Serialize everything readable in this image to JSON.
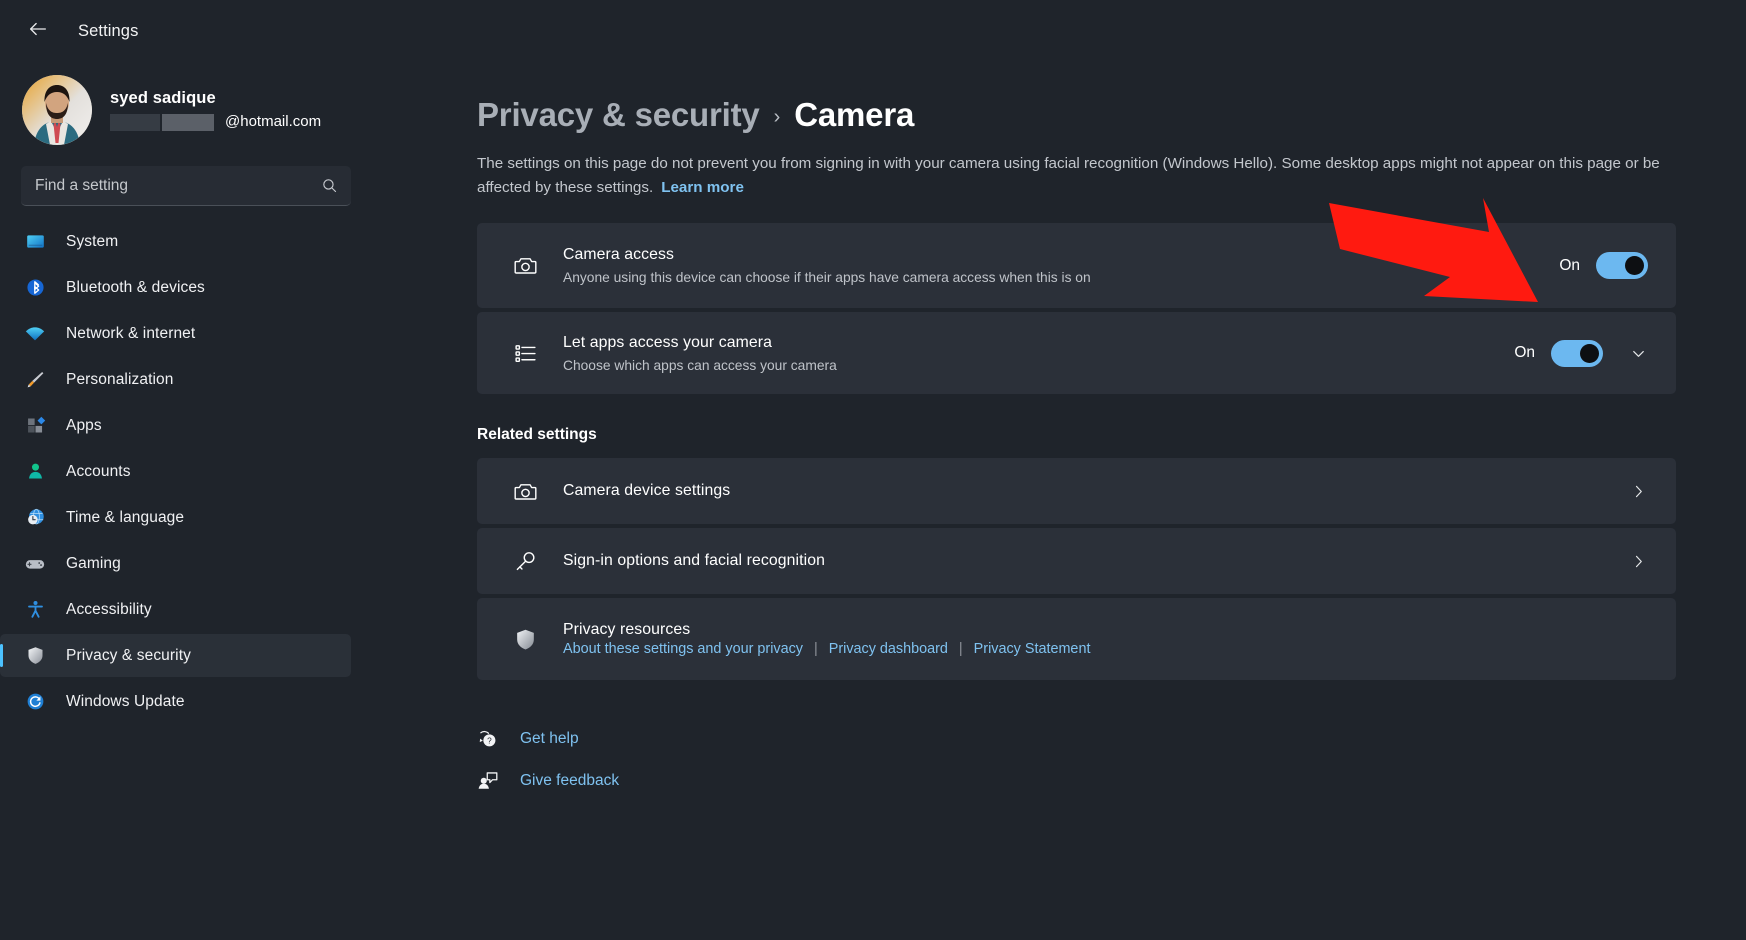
{
  "window": {
    "title": "Settings",
    "back_icon": "back-arrow-icon"
  },
  "account": {
    "name": "syed sadique",
    "email_suffix": "@hotmail.com",
    "email_redacted": true
  },
  "search": {
    "placeholder": "Find a setting",
    "value": "",
    "icon": "search-icon"
  },
  "sidebar": {
    "items": [
      {
        "label": "System",
        "icon": "monitor-icon",
        "selected": false
      },
      {
        "label": "Bluetooth & devices",
        "icon": "bluetooth-icon",
        "selected": false
      },
      {
        "label": "Network & internet",
        "icon": "wifi-icon",
        "selected": false
      },
      {
        "label": "Personalization",
        "icon": "paintbrush-icon",
        "selected": false
      },
      {
        "label": "Apps",
        "icon": "apps-icon",
        "selected": false
      },
      {
        "label": "Accounts",
        "icon": "person-icon",
        "selected": false
      },
      {
        "label": "Time & language",
        "icon": "clock-globe-icon",
        "selected": false
      },
      {
        "label": "Gaming",
        "icon": "gamepad-icon",
        "selected": false
      },
      {
        "label": "Accessibility",
        "icon": "accessibility-icon",
        "selected": false
      },
      {
        "label": "Privacy & security",
        "icon": "shield-icon",
        "selected": true
      },
      {
        "label": "Windows Update",
        "icon": "update-icon",
        "selected": false
      }
    ]
  },
  "header": {
    "breadcrumb_parent": "Privacy & security",
    "breadcrumb_separator": "›",
    "breadcrumb_current": "Camera",
    "description": "The settings on this page do not prevent you from signing in with your camera using facial recognition (Windows Hello). Some desktop apps might not appear on this page or be affected by these settings.",
    "learn_more": "Learn more"
  },
  "settings": {
    "camera_access": {
      "title": "Camera access",
      "subtitle": "Anyone using this device can choose if their apps have camera access when this is on",
      "icon": "camera-icon",
      "toggle_state": "On",
      "toggle_on": true
    },
    "let_apps_access": {
      "title": "Let apps access your camera",
      "subtitle": "Choose which apps can access your camera",
      "icon": "list-icon",
      "toggle_state": "On",
      "toggle_on": true,
      "expand_icon": "chevron-down-icon"
    }
  },
  "related": {
    "heading": "Related settings",
    "items": [
      {
        "title": "Camera device settings",
        "icon": "camera-icon",
        "chevron": "chevron-right-icon"
      },
      {
        "title": "Sign-in options and facial recognition",
        "icon": "key-icon",
        "chevron": "chevron-right-icon"
      }
    ],
    "privacy_resources": {
      "title": "Privacy resources",
      "icon": "shield-icon",
      "links": [
        "About these settings and your privacy",
        "Privacy dashboard",
        "Privacy Statement"
      ],
      "separator": "|"
    }
  },
  "footer": {
    "get_help": {
      "label": "Get help",
      "icon": "help-icon"
    },
    "give_feedback": {
      "label": "Give feedback",
      "icon": "feedback-icon"
    }
  },
  "annotation": {
    "type": "arrow",
    "color": "#FF1A10",
    "points_to": "camera-access-toggle"
  },
  "colors": {
    "background": "#1f242b",
    "card": "#2b3039",
    "accent": "#4cc2ff",
    "link": "#7fc2f0",
    "toggle_on": "#6cb8f0",
    "annotation_red": "#FF1A10"
  }
}
